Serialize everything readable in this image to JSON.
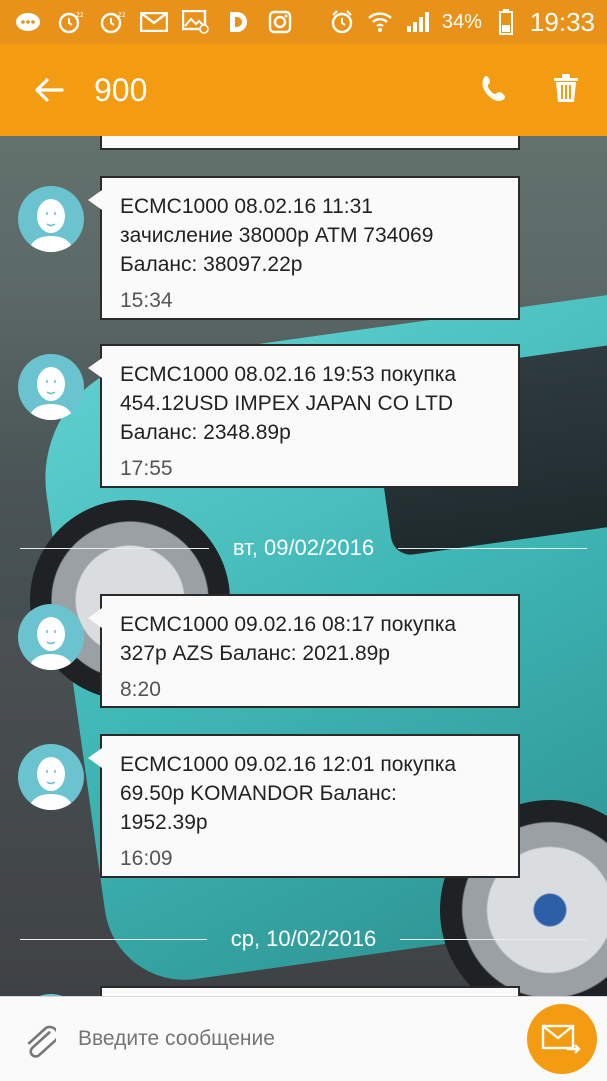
{
  "status_bar": {
    "left_icons": [
      "chat-icon",
      "alarm-icon",
      "alarm-icon",
      "mail-icon",
      "image-mail-icon",
      "d-app-icon",
      "instagram-icon"
    ],
    "right_icons": [
      "alarm-icon",
      "wifi-icon",
      "signal-icon"
    ],
    "battery": "34%",
    "time": "19:33"
  },
  "app_bar": {
    "title": "900",
    "actions": [
      "phone-icon",
      "delete-icon"
    ],
    "color": "#f39c12"
  },
  "messages": [
    {
      "text": "ECMC1000 08.02.16 11:31\nзачисление 38000р ATM 734069\nБаланс: 38097.22р",
      "time": "15:34"
    },
    {
      "text": "ECMC1000 08.02.16 19:53 покупка\n454.12USD IMPEX JAPAN CO LTD\nБаланс: 2348.89р",
      "time": "17:55"
    },
    {
      "text": "ECMC1000 09.02.16 08:17 покупка\n327р AZS Баланс: 2021.89р",
      "time": "8:20"
    },
    {
      "text": "ECMC1000 09.02.16 12:01 покупка\n69.50р KOMANDOR Баланс:\n1952.39р",
      "time": "16:09"
    }
  ],
  "dividers": [
    "вт, 09/02/2016",
    "ср, 10/02/2016"
  ],
  "input": {
    "placeholder": "Введите сообщение"
  }
}
